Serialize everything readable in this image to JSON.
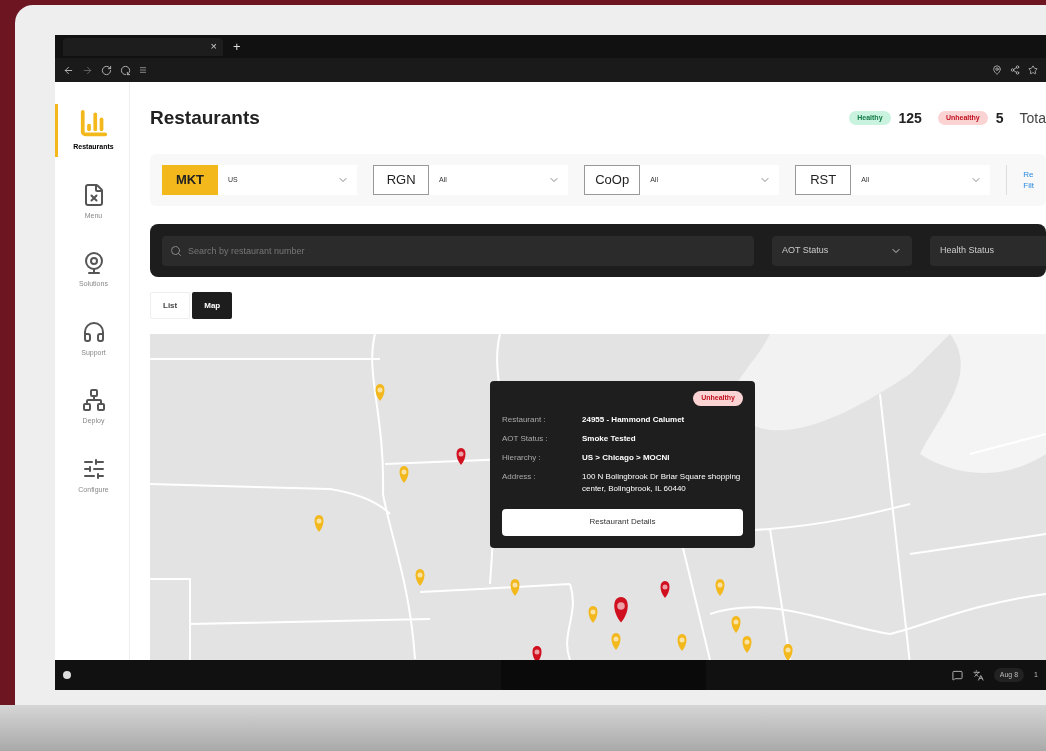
{
  "browser": {
    "tab_close": "×",
    "tab_new": "+"
  },
  "sidebar": {
    "items": [
      {
        "label": "Restaurants",
        "selected": true,
        "kind": "chart"
      },
      {
        "label": "Menu",
        "selected": false,
        "kind": "menu"
      },
      {
        "label": "Solutions",
        "selected": false,
        "kind": "solutions"
      },
      {
        "label": "Support",
        "selected": false,
        "kind": "support"
      },
      {
        "label": "Deploy",
        "selected": false,
        "kind": "deploy"
      },
      {
        "label": "Configure",
        "selected": false,
        "kind": "configure"
      }
    ]
  },
  "header": {
    "title": "Restaurants",
    "counts": [
      {
        "label": "Healthy",
        "value": "125",
        "kind": "healthy"
      },
      {
        "label": "Unhealthy",
        "value": "5",
        "kind": "unhealthy"
      }
    ],
    "total_label": "Tota"
  },
  "filters": [
    {
      "label": "MKT",
      "value": "US",
      "selected": true
    },
    {
      "label": "RGN",
      "value": "All",
      "selected": false
    },
    {
      "label": "CoOp",
      "value": "All",
      "selected": false
    },
    {
      "label": "RST",
      "value": "All",
      "selected": false
    }
  ],
  "reset_link": {
    "lines": [
      "Re",
      "Filt"
    ]
  },
  "search": {
    "placeholder": "Search by restaurant number",
    "dropdowns": [
      "AOT Status",
      "Health Status"
    ]
  },
  "view_tabs": [
    {
      "label": "List",
      "selected": false
    },
    {
      "label": "Map",
      "selected": true
    }
  ],
  "map_pins": [
    {
      "color": "#f2b81c"
    },
    {
      "color": "#d0101f"
    },
    {
      "color": "#f2b81c"
    },
    {
      "color": "#f2b81c"
    },
    {
      "color": "#f2b81c"
    },
    {
      "color": "#d0101f"
    },
    {
      "color": "#f2b81c"
    },
    {
      "color": "#d0101f"
    },
    {
      "color": "#f2b81c"
    },
    {
      "color": "#f2b81c"
    },
    {
      "color": "#f2b81c"
    },
    {
      "color": "#f2b81c"
    },
    {
      "color": "#f2b81c"
    },
    {
      "color": "#f2b81c"
    },
    {
      "color": "#d0101f"
    },
    {
      "color": "#f2b81c"
    }
  ],
  "popup": {
    "status": "Unhealthy",
    "fields": [
      {
        "label": "Restaurant :",
        "value": "24955 - Hammond Calumet",
        "bold": true
      },
      {
        "label": "AOT Status :",
        "value": "Smoke Tested",
        "bold": true
      },
      {
        "label": "Hierarchy :",
        "value": "US > Chicago > MOCNI",
        "bold": true
      },
      {
        "label": "Address :",
        "value": "100 N Bolingbrook Dr Briar Square shopping center, Bolingbrook, IL 60440",
        "bold": false
      }
    ],
    "button": "Restaurant Details"
  },
  "taskbar": {
    "date": "Aug 8",
    "time": "1"
  }
}
